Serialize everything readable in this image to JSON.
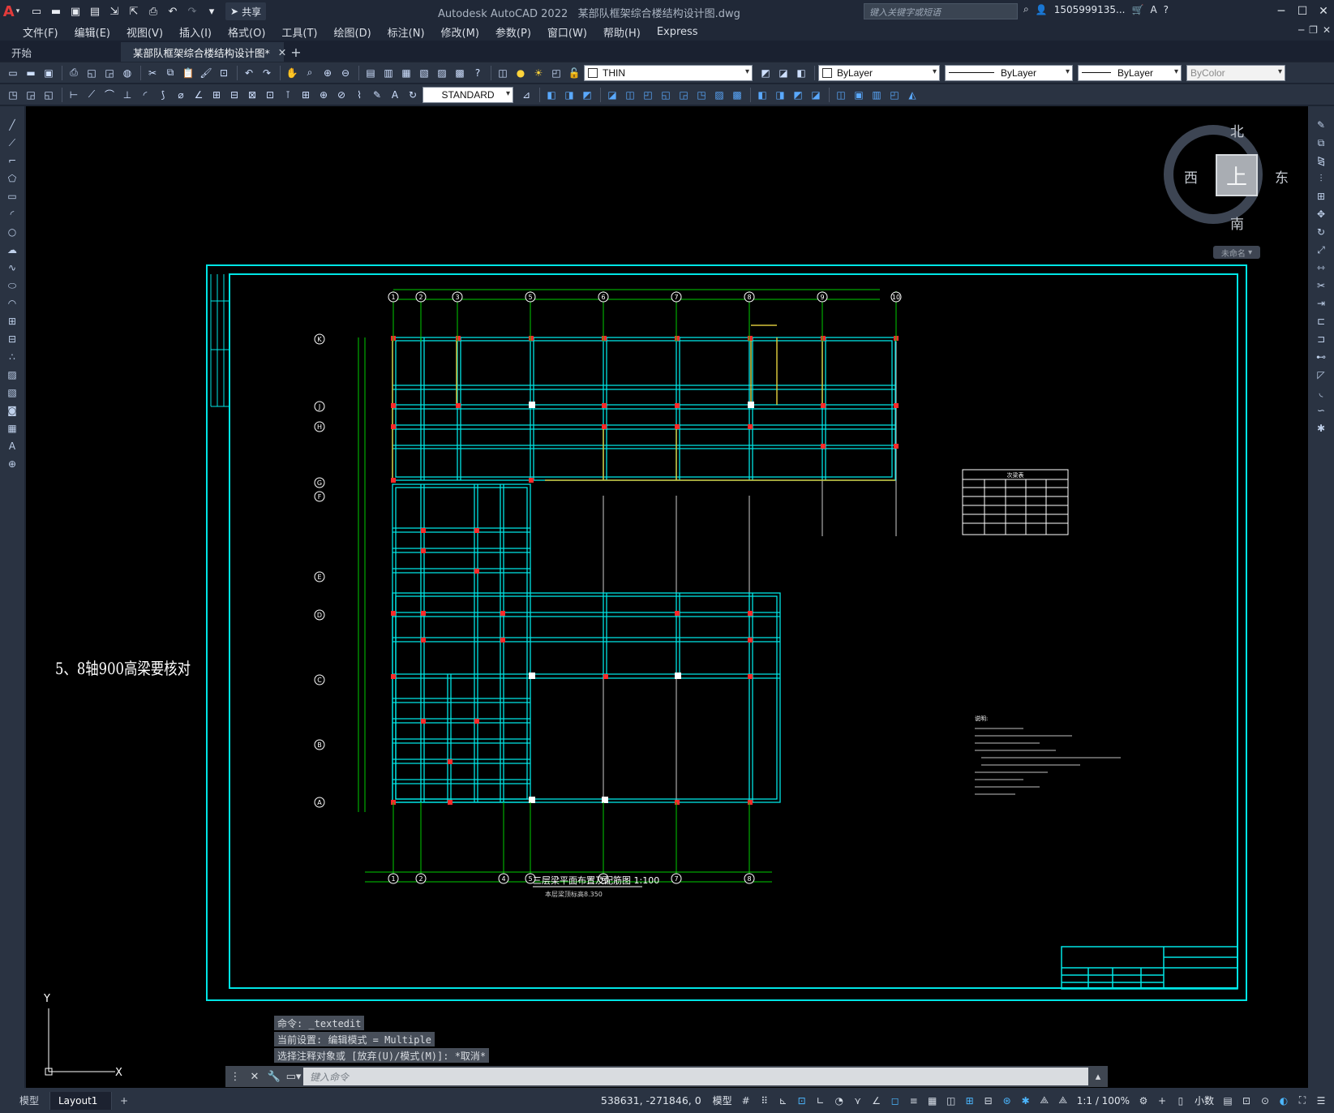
{
  "app": {
    "title": "Autodesk AutoCAD 2022",
    "file": "某部队框架综合楼结构设计图.dwg",
    "search_placeholder": "键入关键字或短语",
    "user": "1505999135...",
    "logo": "A"
  },
  "qat": {
    "share": "共享",
    "icons": [
      "new-icon",
      "open-icon",
      "save-icon",
      "saveas-icon",
      "import-icon",
      "export-icon",
      "print-icon",
      "undo-icon",
      "redo-icon",
      "customize-icon"
    ]
  },
  "menu": {
    "items": [
      "文件(F)",
      "编辑(E)",
      "视图(V)",
      "插入(I)",
      "格式(O)",
      "工具(T)",
      "绘图(D)",
      "标注(N)",
      "修改(M)",
      "参数(P)",
      "窗口(W)",
      "帮助(H)",
      "Express"
    ]
  },
  "tabs": {
    "start": "开始",
    "active": "某部队框架综合楼结构设计图*",
    "close": "✕",
    "plus": "+"
  },
  "toolbar": {
    "layer": "THIN",
    "color": "ByLayer",
    "linetype": "ByLayer",
    "lineweight": "ByLayer",
    "plotstyle": "ByColor",
    "textstyle": "STANDARD"
  },
  "viewcube": {
    "top": "上",
    "north": "北",
    "south": "南",
    "east": "东",
    "west": "西",
    "wcs": "未命名"
  },
  "drawing": {
    "note": "5、8轴900高梁要核对",
    "plan_title": "三层梁平面布置及配筋图  1:100",
    "plan_subtitle": "本层梁顶标高8.350",
    "top_axes": [
      "1",
      "2",
      "3",
      "5",
      "6",
      "7",
      "8",
      "9",
      "10"
    ],
    "bottom_axes": [
      "1",
      "2",
      "4",
      "5",
      "6",
      "7",
      "8"
    ],
    "left_axes": [
      "K",
      "J",
      "H",
      "G",
      "F",
      "E",
      "D",
      "C",
      "B",
      "A"
    ],
    "schedule_title": "次梁表",
    "notes_heading": "说明:",
    "ucs_y": "Y",
    "ucs_x": "X"
  },
  "command": {
    "lines": [
      "命令: _textedit",
      "当前设置: 编辑模式 = Multiple",
      "选择注释对象或 [放弃(U)/模式(M)]: *取消*"
    ],
    "placeholder": "键入命令"
  },
  "status": {
    "model_tab": "模型",
    "layout_tab": "Layout1",
    "plus": "+",
    "coords": "538631, -271846, 0",
    "space": "模型",
    "scale": "1:1 / 100%",
    "units": "小数"
  }
}
